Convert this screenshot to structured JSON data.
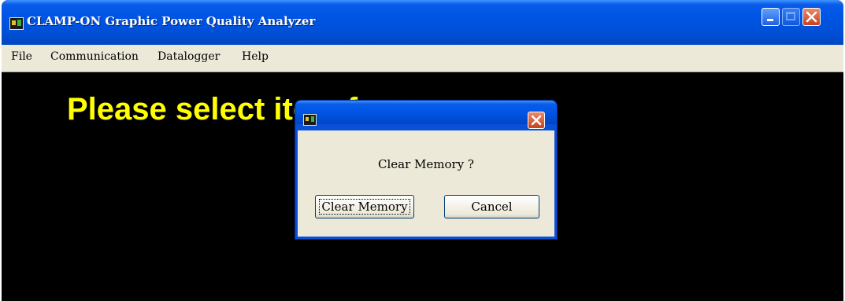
{
  "window": {
    "title": "CLAMP-ON Graphic Power Quality Analyzer",
    "icon": "app-icon"
  },
  "menu": {
    "items": [
      "File",
      "Communication",
      "Datalogger",
      "Help"
    ]
  },
  "client": {
    "message": "Please select item from menu ...",
    "message_color": "#ffff00",
    "background": "#000000"
  },
  "dialog": {
    "message": "Clear Memory ?",
    "confirm_label": "Clear Memory",
    "cancel_label": "Cancel"
  }
}
